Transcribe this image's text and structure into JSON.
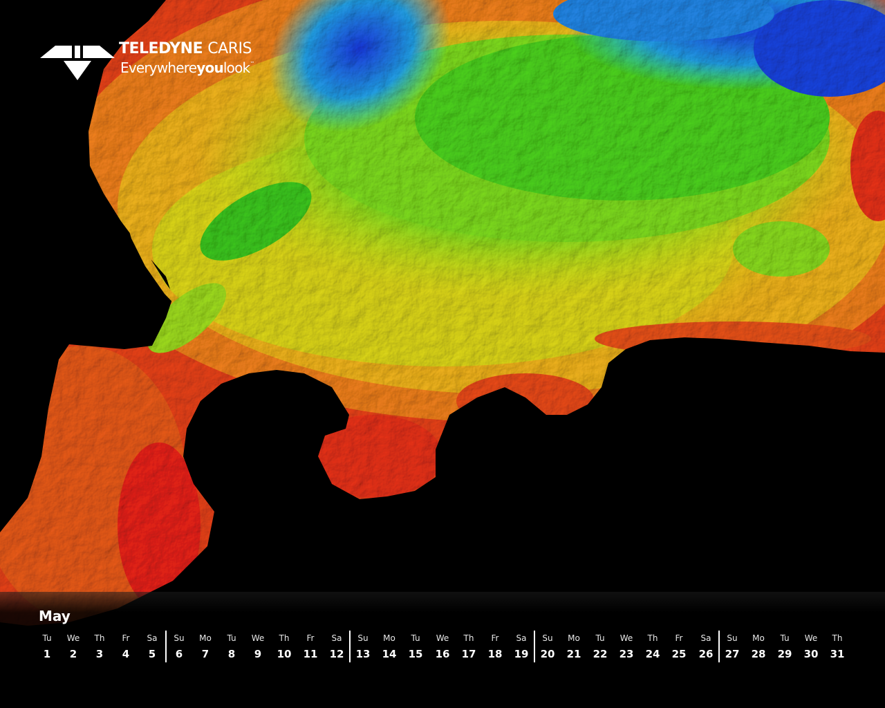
{
  "brand": {
    "name_bold": "TELEDYNE",
    "name_light": "CARIS",
    "tagline_part1": "Everywhere",
    "tagline_part2": "you",
    "tagline_part3": "look",
    "tagline_tm": "™"
  },
  "calendar": {
    "month": "May",
    "days": [
      {
        "dow": "Tu",
        "num": "1"
      },
      {
        "dow": "We",
        "num": "2"
      },
      {
        "dow": "Th",
        "num": "3"
      },
      {
        "dow": "Fr",
        "num": "4"
      },
      {
        "dow": "Sa",
        "num": "5"
      },
      {
        "dow": "Su",
        "num": "6"
      },
      {
        "dow": "Mo",
        "num": "7"
      },
      {
        "dow": "Tu",
        "num": "8"
      },
      {
        "dow": "We",
        "num": "9"
      },
      {
        "dow": "Th",
        "num": "10"
      },
      {
        "dow": "Fr",
        "num": "11"
      },
      {
        "dow": "Sa",
        "num": "12"
      },
      {
        "dow": "Su",
        "num": "13"
      },
      {
        "dow": "Mo",
        "num": "14"
      },
      {
        "dow": "Tu",
        "num": "15"
      },
      {
        "dow": "We",
        "num": "16"
      },
      {
        "dow": "Th",
        "num": "17"
      },
      {
        "dow": "Fr",
        "num": "18"
      },
      {
        "dow": "Sa",
        "num": "19"
      },
      {
        "dow": "Su",
        "num": "20"
      },
      {
        "dow": "Mo",
        "num": "21"
      },
      {
        "dow": "Tu",
        "num": "22"
      },
      {
        "dow": "We",
        "num": "23"
      },
      {
        "dow": "Th",
        "num": "24"
      },
      {
        "dow": "Fr",
        "num": "25"
      },
      {
        "dow": "Sa",
        "num": "26"
      },
      {
        "dow": "Su",
        "num": "27"
      },
      {
        "dow": "Mo",
        "num": "28"
      },
      {
        "dow": "Tu",
        "num": "29"
      },
      {
        "dow": "We",
        "num": "30"
      },
      {
        "dow": "Th",
        "num": "31"
      }
    ]
  },
  "colors": {
    "background": "#000000",
    "depth_shallow": "#e8121a",
    "depth_mid_shallow": "#f07a1c",
    "depth_mid": "#e8e21a",
    "depth_mid_deep": "#5ed81e",
    "depth_deep": "#22c8e6",
    "depth_deepest": "#1a3ae0",
    "text": "#ffffff"
  }
}
